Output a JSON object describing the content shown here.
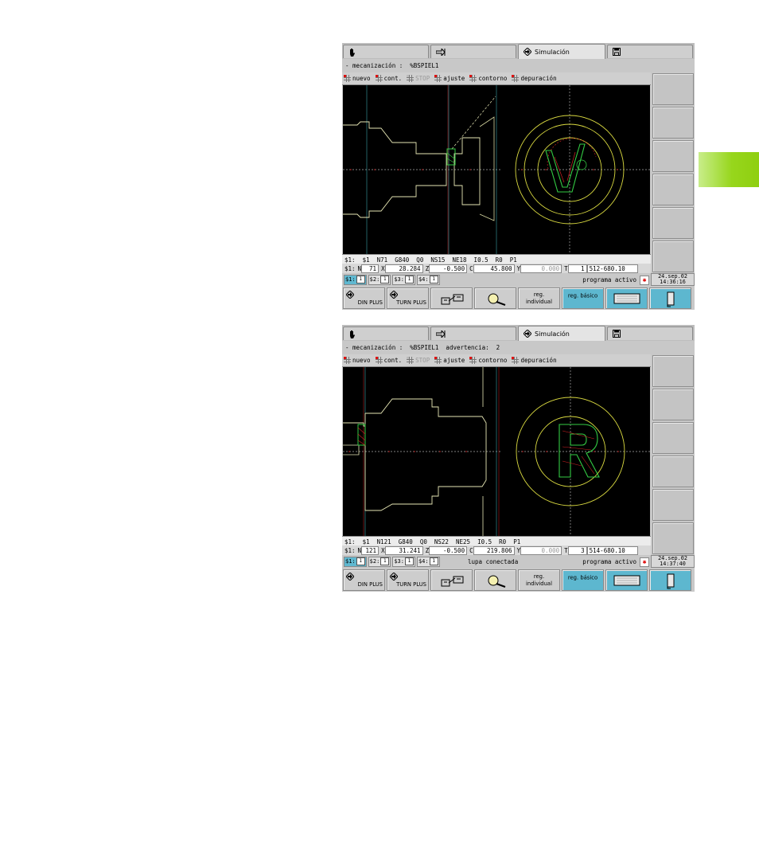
{
  "side_tab_color": "#97d61c",
  "screens": [
    {
      "tabs": [
        {
          "icon": "hand-icon",
          "label": ""
        },
        {
          "icon": "arrow-into-icon",
          "label": ""
        },
        {
          "icon": "simulation-icon",
          "label": "Simulación"
        },
        {
          "icon": "floppy-disk-icon",
          "label": ""
        }
      ],
      "mode_line": "- mecanización :  %BSPIEL1",
      "toolbar": [
        "nuevo",
        "cont.",
        "STOP",
        "ajuste",
        "contorno",
        "depuración"
      ],
      "info_line": "$1:  $1  N71  G840  Q0  NS15  NE18  I0.5  R0  P1",
      "position": {
        "channel": "$1:",
        "N_label": "N",
        "N": "71",
        "X": "28.284",
        "Z": "-0.500",
        "C": "45.800",
        "Y": "0.000",
        "T": "1",
        "tool": "512-680.10"
      },
      "channels": [
        "$1:",
        "$2:",
        "$3:",
        "$4:"
      ],
      "status": "programa activo",
      "date": "24.sep.02",
      "time": "14:36:16",
      "fkeys": {
        "din_plus": "DIN PLUS",
        "turn_plus": "TURN PLUS",
        "reg_individual": "reg.\nindividual",
        "reg_basico": "reg. básico"
      }
    },
    {
      "tabs": [
        {
          "icon": "hand-icon",
          "label": ""
        },
        {
          "icon": "arrow-into-icon",
          "label": ""
        },
        {
          "icon": "simulation-icon",
          "label": "Simulación"
        },
        {
          "icon": "floppy-disk-icon",
          "label": ""
        }
      ],
      "mode_line": "- mecanización :  %BSPIEL1  advertencia:  2",
      "toolbar": [
        "nuevo",
        "cont.",
        "STOP",
        "ajuste",
        "contorno",
        "depuración"
      ],
      "info_line": "$1:  $1  N121  G840  Q0  NS22  NE25  I0.5  R0  P1",
      "position": {
        "channel": "$1:",
        "N_label": "N",
        "N": "121",
        "X": "31.241",
        "Z": "-0.500",
        "C": "219.806",
        "Y": "0.000",
        "T": "3",
        "tool": "514-680.10"
      },
      "channels": [
        "$1:",
        "$2:",
        "$3:",
        "$4:"
      ],
      "status": "programa activo",
      "status_center": "lupa conectada",
      "date": "24.sep.02",
      "time": "14:37:40",
      "fkeys": {
        "din_plus": "DIN PLUS",
        "turn_plus": "TURN PLUS",
        "reg_individual": "reg.\nindividual",
        "reg_basico": "reg. básico"
      }
    }
  ]
}
